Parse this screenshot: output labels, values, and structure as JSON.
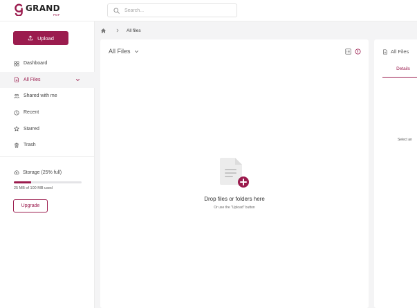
{
  "brand": {
    "name": "GRAND",
    "sub": "PDF",
    "accent": "#9b1c4e"
  },
  "search": {
    "placeholder": "Search...",
    "value": ""
  },
  "sidebar": {
    "upload_label": "Upload",
    "items": [
      {
        "label": "Dashboard",
        "icon": "dashboard-icon"
      },
      {
        "label": "All Files",
        "icon": "file-icon",
        "active": true
      },
      {
        "label": "Shared with me",
        "icon": "users-icon"
      },
      {
        "label": "Recent",
        "icon": "clock-icon"
      },
      {
        "label": "Starred",
        "icon": "star-icon"
      },
      {
        "label": "Trash",
        "icon": "trash-icon"
      }
    ],
    "storage": {
      "label": "Storage (25% full)",
      "percent": 25,
      "used_text": "25 MB of 100 MB used"
    },
    "upgrade_label": "Upgrade"
  },
  "breadcrumb": {
    "current": "All files"
  },
  "main": {
    "title": "All Files",
    "drop_title": "Drop files or folders here",
    "drop_subtitle": "Or use the \"Upload\" button"
  },
  "details": {
    "title": "All Files",
    "tab_label": "Details",
    "empty_text": "Select an"
  }
}
